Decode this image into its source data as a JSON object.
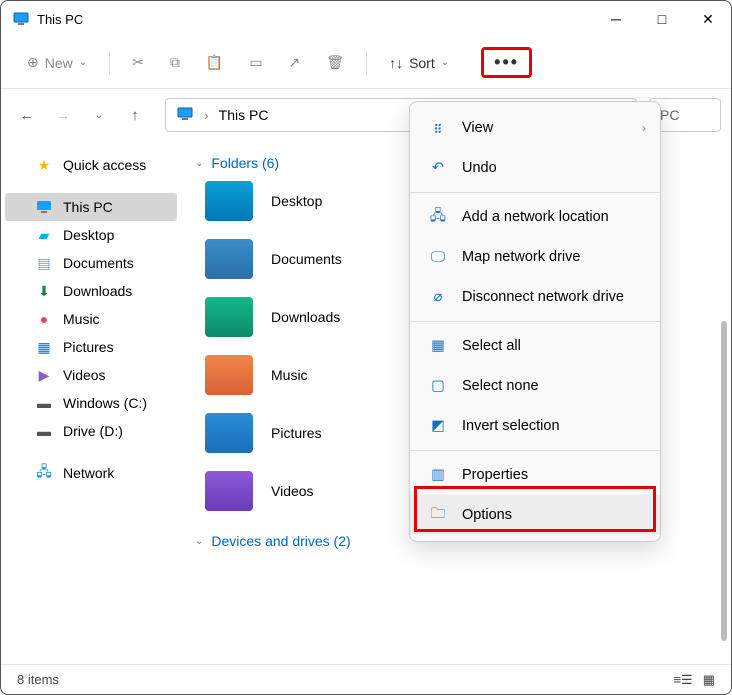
{
  "window": {
    "title": "This PC"
  },
  "toolbar": {
    "new": "New",
    "sort": "Sort",
    "more": "⋯"
  },
  "address": {
    "location": "This PC",
    "sep": "›",
    "search_placeholder": "PC"
  },
  "sidebar": {
    "quick_access": "Quick access",
    "this_pc": "This PC",
    "items": [
      {
        "label": "Desktop"
      },
      {
        "label": "Documents"
      },
      {
        "label": "Downloads"
      },
      {
        "label": "Music"
      },
      {
        "label": "Pictures"
      },
      {
        "label": "Videos"
      },
      {
        "label": "Windows (C:)"
      },
      {
        "label": "Drive (D:)"
      }
    ],
    "network": "Network"
  },
  "content": {
    "folders_header": "Folders (6)",
    "folders": [
      {
        "label": "Desktop"
      },
      {
        "label": "Documents"
      },
      {
        "label": "Downloads"
      },
      {
        "label": "Music"
      },
      {
        "label": "Pictures"
      },
      {
        "label": "Videos"
      }
    ],
    "devices_header": "Devices and drives (2)"
  },
  "menu": {
    "view": "View",
    "undo": "Undo",
    "add_network": "Add a network location",
    "map_drive": "Map network drive",
    "disconnect_drive": "Disconnect network drive",
    "select_all": "Select all",
    "select_none": "Select none",
    "invert": "Invert selection",
    "properties": "Properties",
    "options": "Options"
  },
  "status": {
    "items": "8 items"
  }
}
